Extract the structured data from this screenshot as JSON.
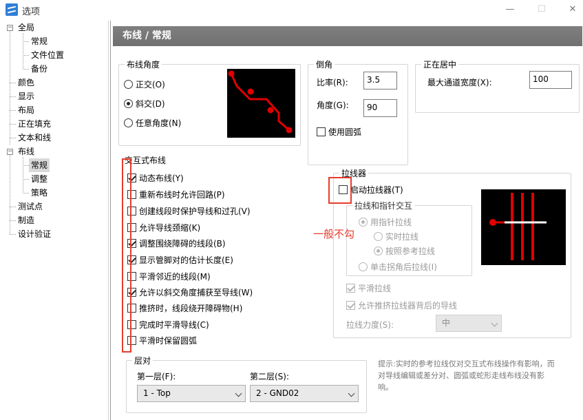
{
  "window": {
    "title": "选项",
    "minimize_icon": "—",
    "maximize_icon": "☐",
    "close_icon": "✕"
  },
  "tree": {
    "items": [
      {
        "label": "全局",
        "toggle": "−"
      },
      {
        "label": "常规"
      },
      {
        "label": "文件位置"
      },
      {
        "label": "备份"
      },
      {
        "label": "颜色"
      },
      {
        "label": "显示"
      },
      {
        "label": "布局"
      },
      {
        "label": "正在填充"
      },
      {
        "label": "文本和线"
      },
      {
        "label": "布线",
        "toggle": "−"
      },
      {
        "label": "常规"
      },
      {
        "label": "调整"
      },
      {
        "label": "策略"
      },
      {
        "label": "测试点"
      },
      {
        "label": "制造"
      },
      {
        "label": "设计验证"
      }
    ]
  },
  "page": {
    "header": "布线 / 常规"
  },
  "routing_angle": {
    "title": "布线角度",
    "options": [
      "正交(O)",
      "斜交(D)",
      "任意角度(N)"
    ],
    "selected_index": 1
  },
  "miter": {
    "title": "倒角",
    "ratio_label": "比率(R):",
    "ratio_value": "3.5",
    "angle_label": "角度(G):",
    "angle_value": "90",
    "use_arc_label": "使用圆弧",
    "use_arc_checked": false
  },
  "centering": {
    "title": "正在居中",
    "max_channel_label": "最大通道宽度(X):",
    "max_channel_value": "100"
  },
  "interactive": {
    "title": "交互式布线",
    "options": [
      {
        "label": "动态布线(Y)",
        "checked": true
      },
      {
        "label": "重新布线时允许回路(P)",
        "checked": false
      },
      {
        "label": "创建线段时保护导线和过孔(V)",
        "checked": false
      },
      {
        "label": "允许导线颈缩(K)",
        "checked": false
      },
      {
        "label": "调整围绕障碍的线段(B)",
        "checked": true
      },
      {
        "label": "显示管脚对的估计长度(E)",
        "checked": true
      },
      {
        "label": "平滑邻近的线段(M)",
        "checked": false
      },
      {
        "label": "允许以斜交角度捕获至导线(W)",
        "checked": true
      },
      {
        "label": "推挤时，线段绕开障碍物(H)",
        "checked": false
      },
      {
        "label": "完成时平滑导线(C)",
        "checked": false
      },
      {
        "label": "平滑时保留圆弧",
        "checked": false
      }
    ]
  },
  "puller": {
    "title": "拉线器",
    "enable_label": "启动拉线器(T)",
    "enable_checked": false,
    "interaction_title": "拉线和指针交互",
    "pointer_pull_label": "用指针拉线",
    "realtime_label": "实时拉线",
    "reference_label": "按照参考拉线",
    "corner_label": "单击拐角后拉线(I)",
    "smooth_label": "平滑拉线",
    "smooth_checked": true,
    "allow_push_label": "允许推挤拉线器背后的导线",
    "allow_push_checked": true,
    "strength_label": "拉线力度(S):",
    "strength_value": "中"
  },
  "annotation": {
    "text": "一般不勾",
    "color": "#e63c2c"
  },
  "layer_pair": {
    "title": "层对",
    "first_label": "第一层(F):",
    "first_value": "1 - Top",
    "second_label": "第二层(S):",
    "second_value": "2 - GND02"
  },
  "hint": {
    "text": "提示:实时的参考拉线仅对交互式布线操作有影响，而对导线编辑或差分对、圆弧或蛇形走线布线没有影响。"
  },
  "colors": {
    "header_bg": "#7a7a7a",
    "trace_red": "#e00000",
    "annotation_red": "#e63c2c"
  }
}
